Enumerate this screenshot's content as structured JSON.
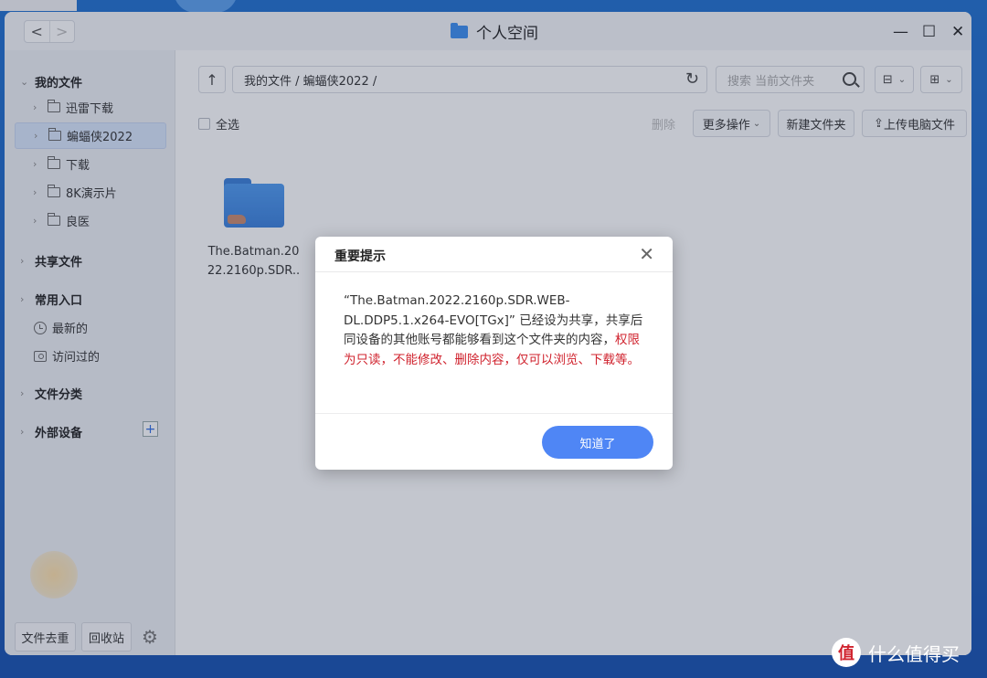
{
  "window": {
    "title": "个人空间",
    "nav_back": "<",
    "nav_forward": ">",
    "ctrl_min": "—",
    "ctrl_max": "☐",
    "ctrl_close": "✕"
  },
  "sidebar": {
    "my_files": "我的文件",
    "folders": [
      "迅雷下载",
      "蝙蝠侠2022",
      "下载",
      "8K演示片",
      "良医"
    ],
    "shared": "共享文件",
    "quick": "常用入口",
    "recent": "最新的",
    "visited": "访问过的",
    "category": "文件分类",
    "external": "外部设备",
    "plus": "+",
    "dedup": "文件去重",
    "recycle": "回收站"
  },
  "toolbar": {
    "path": "我的文件 / 蝙蝠侠2022 /",
    "search_placeholder": "搜索 当前文件夹",
    "select_all": "全选",
    "delete": "删除",
    "more": "更多操作",
    "new_folder": "新建文件夹",
    "upload": "上传电脑文件"
  },
  "files": [
    {
      "name_line1": "The.Batman.20",
      "name_line2": "22.2160p.SDR.."
    }
  ],
  "dialog": {
    "title": "重要提示",
    "message_normal": "“The.Batman.2022.2160p.SDR.WEB-DL.DDP5.1.x264-EVO[TGx]” 已经设为共享，共享后同设备的其他账号都能够看到这个文件夹的内容，",
    "message_warn": "权限为只读，不能修改、删除内容，仅可以浏览、下载等。",
    "ok": "知道了",
    "close": "✕"
  },
  "watermark": {
    "badge": "值",
    "text": "什么值得买"
  },
  "colors": {
    "accent": "#4f86f5",
    "warn": "#d0232e",
    "folder": "#3b8ef0"
  }
}
